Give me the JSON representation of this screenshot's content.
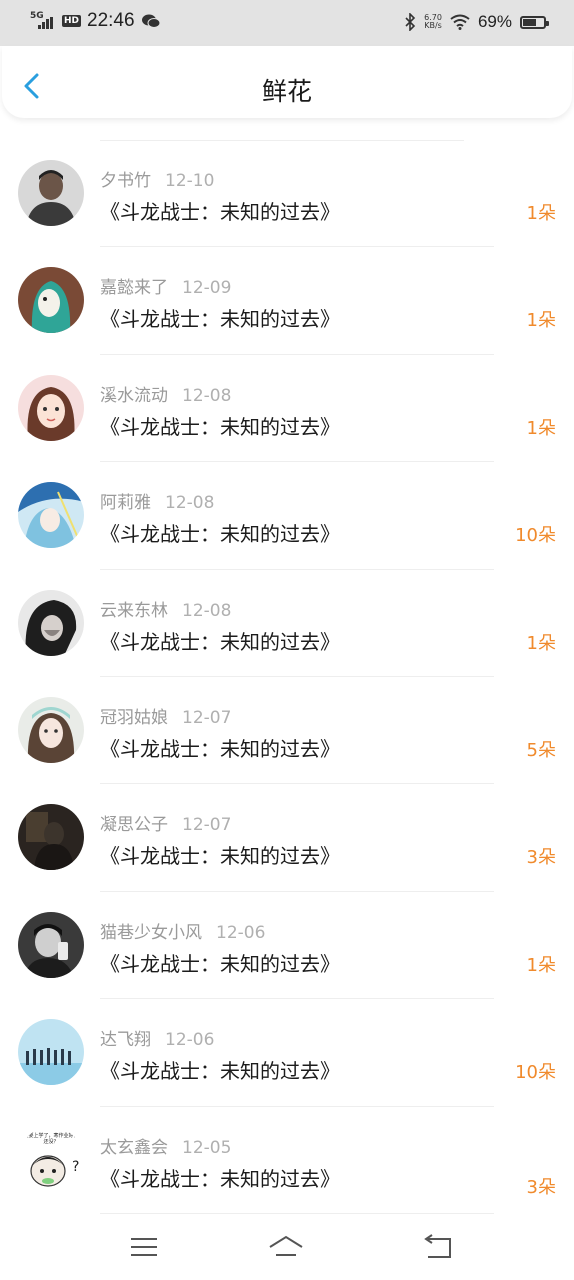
{
  "status_bar": {
    "network": "5G",
    "hd": "HD",
    "time": "22:46",
    "speed_value": "6.70",
    "speed_unit": "KB/s",
    "battery": "69%",
    "icons": [
      "signal-icon",
      "wechat-icon",
      "bluetooth-icon",
      "wifi-icon",
      "battery-icon"
    ]
  },
  "header": {
    "title": "鲜花",
    "back_icon": "chevron-left-icon"
  },
  "colors": {
    "accent": "#2a9fdf",
    "count": "#f08a2c",
    "muted": "#9a9a9a"
  },
  "list": [
    {
      "name": "夕书竹",
      "date": "12-10",
      "book": "《斗龙战士：未知的过去》",
      "count": "1朵"
    },
    {
      "name": "嘉懿来了",
      "date": "12-09",
      "book": "《斗龙战士：未知的过去》",
      "count": "1朵"
    },
    {
      "name": "溪水流动",
      "date": "12-08",
      "book": "《斗龙战士：未知的过去》",
      "count": "1朵"
    },
    {
      "name": "阿莉雅",
      "date": "12-08",
      "book": "《斗龙战士：未知的过去》",
      "count": "10朵"
    },
    {
      "name": "云来东林",
      "date": "12-08",
      "book": "《斗龙战士：未知的过去》",
      "count": "1朵"
    },
    {
      "name": "冠羽姑娘",
      "date": "12-07",
      "book": "《斗龙战士：未知的过去》",
      "count": "5朵"
    },
    {
      "name": "凝思公子",
      "date": "12-07",
      "book": "《斗龙战士：未知的过去》",
      "count": "3朵"
    },
    {
      "name": "猫巷少女小风",
      "date": "12-06",
      "book": "《斗龙战士：未知的过去》",
      "count": "1朵"
    },
    {
      "name": "达飞翔",
      "date": "12-06",
      "book": "《斗龙战士：未知的过去》",
      "count": "10朵"
    },
    {
      "name": "太玄鑫会",
      "date": "12-05",
      "book": "《斗龙战士：未知的过去》",
      "count": "3朵"
    }
  ],
  "avatar_stickers": {
    "last_avatar_text": "天要上学了，寒作业好做还没？"
  },
  "bottom_nav": {
    "icons": [
      "menu-icon",
      "home-icon",
      "back-icon"
    ]
  }
}
